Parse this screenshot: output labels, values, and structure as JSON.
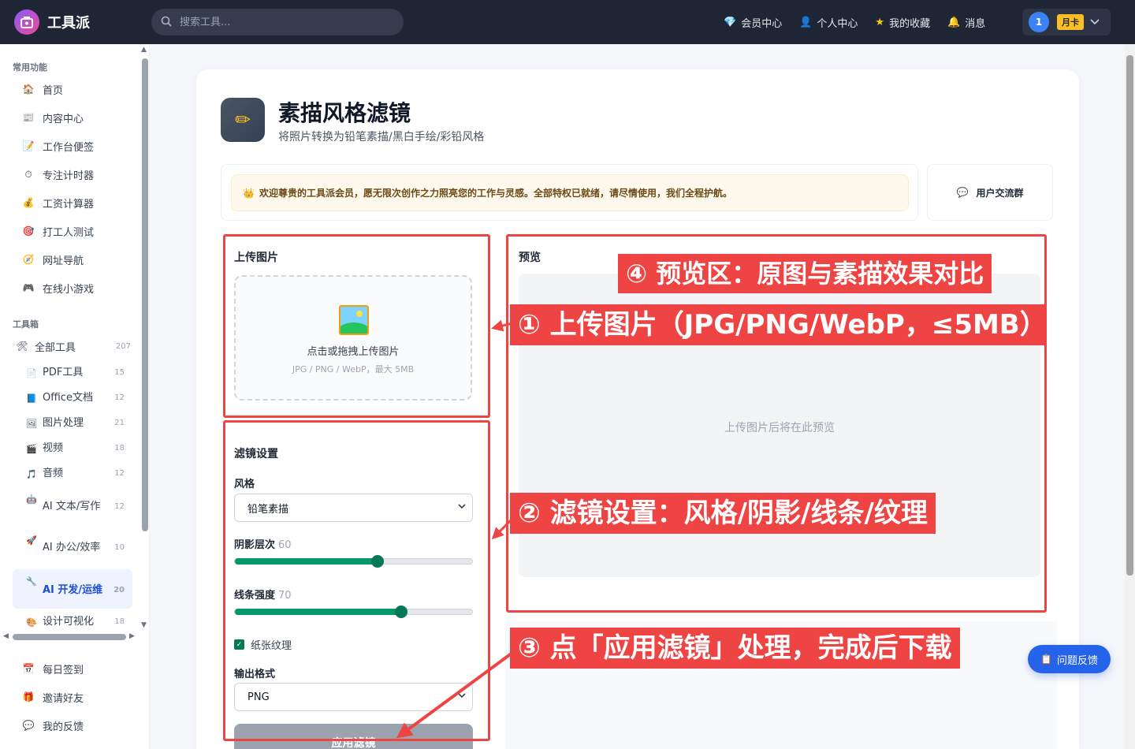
{
  "app": {
    "name": "工具派",
    "search_placeholder": "搜索工具...",
    "top_nav": [
      {
        "label": "会员中心",
        "icon": "gem-icon"
      },
      {
        "label": "个人中心",
        "icon": "person-icon"
      },
      {
        "label": "我的收藏",
        "icon": "star-icon"
      },
      {
        "label": "消息",
        "icon": "bell-icon"
      }
    ],
    "user": {
      "avatar_text": "1",
      "plan": "月卡"
    }
  },
  "sidebar": {
    "common_title": "常用功能",
    "common": [
      {
        "label": "首页",
        "icon": "🏠"
      },
      {
        "label": "内容中心",
        "icon": "📰"
      },
      {
        "label": "工作台便签",
        "icon": "📝"
      },
      {
        "label": "专注计时器",
        "icon": "⏱"
      },
      {
        "label": "工资计算器",
        "icon": "💰"
      },
      {
        "label": "打工人测试",
        "icon": "🎯"
      },
      {
        "label": "网址导航",
        "icon": "🧭"
      },
      {
        "label": "在线小游戏",
        "icon": "🎮"
      }
    ],
    "tools_title": "工具箱",
    "all_tools": {
      "label": "全部工具",
      "icon": "🛠",
      "count": "207"
    },
    "tools": [
      {
        "label": "PDF工具",
        "icon": "📄",
        "count": "15"
      },
      {
        "label": "Office文档",
        "icon": "📘",
        "count": "12"
      },
      {
        "label": "图片处理",
        "icon": "🖼",
        "count": "21"
      },
      {
        "label": "视频",
        "icon": "🎬",
        "count": "18"
      },
      {
        "label": "音频",
        "icon": "🎵",
        "count": "12"
      },
      {
        "label": "AI 文本/写作",
        "icon": "🤖",
        "count": "12"
      },
      {
        "label": "AI 办公/效率",
        "icon": "🚀",
        "count": "10"
      },
      {
        "label": "AI 开发/运维",
        "icon": "🔧",
        "count": "20"
      },
      {
        "label": "设计可视化",
        "icon": "🎨",
        "count": "18"
      }
    ],
    "bottom": [
      {
        "label": "每日签到",
        "icon": "📅"
      },
      {
        "label": "邀请好友",
        "icon": "🎁"
      },
      {
        "label": "我的反馈",
        "icon": "💬"
      }
    ]
  },
  "page": {
    "title": "素描风格滤镜",
    "subtitle": "将照片转换为铅笔素描/黑白手绘/彩铅风格",
    "welcome": "欢迎尊贵的工具派会员，愿无限次创作之力照亮您的工作与灵感。全部特权已就绪，请尽情使用，我们全程护航。",
    "group_label": "用户交流群"
  },
  "upload": {
    "title": "上传图片",
    "main_text": "点击或拖拽上传图片",
    "hint": "JPG / PNG / WebP，最大 5MB"
  },
  "filter": {
    "title": "滤镜设置",
    "style_label": "风格",
    "style_value": "铅笔素描",
    "shadow_label": "阴影层次",
    "shadow_value": 60,
    "line_label": "线条强度",
    "line_value": 70,
    "texture_label": "纸张纹理",
    "texture_checked": true,
    "format_label": "输出格式",
    "format_value": "PNG",
    "apply_label": "应用滤镜"
  },
  "preview": {
    "title": "预览",
    "empty_text": "上传图片后将在此预览"
  },
  "annotations": {
    "a1": "① 上传图片（JPG/PNG/WebP，≤5MB）",
    "a2": "② 滤镜设置：风格/阴影/线条/纹理",
    "a3": "③ 点「应用滤镜」处理，完成后下载",
    "a4": "④ 预览区：原图与素描效果对比",
    "color": "#ef4444"
  },
  "feedback_label": "问题反馈"
}
